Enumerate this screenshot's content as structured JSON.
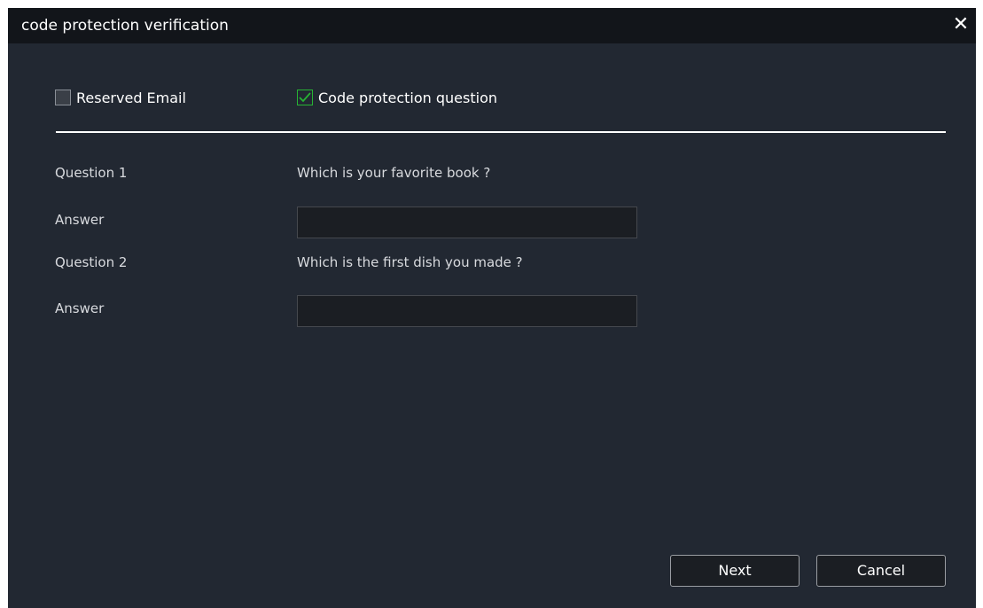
{
  "window": {
    "title": "code protection verification",
    "close_glyph": "✕"
  },
  "options": {
    "reserved_email": {
      "label": "Reserved Email",
      "checked": false
    },
    "protection_question": {
      "label": "Code protection question",
      "checked": true
    }
  },
  "questions": [
    {
      "label": "Question 1",
      "text": "Which is your favorite book ?",
      "answer_label": "Answer",
      "answer_value": ""
    },
    {
      "label": "Question 2",
      "text": "Which is the first dish you made ?",
      "answer_label": "Answer",
      "answer_value": ""
    }
  ],
  "buttons": {
    "next": "Next",
    "cancel": "Cancel"
  },
  "colors": {
    "check_accent": "#27b434",
    "window_bg": "#222832",
    "titlebar_bg": "#12151a"
  }
}
